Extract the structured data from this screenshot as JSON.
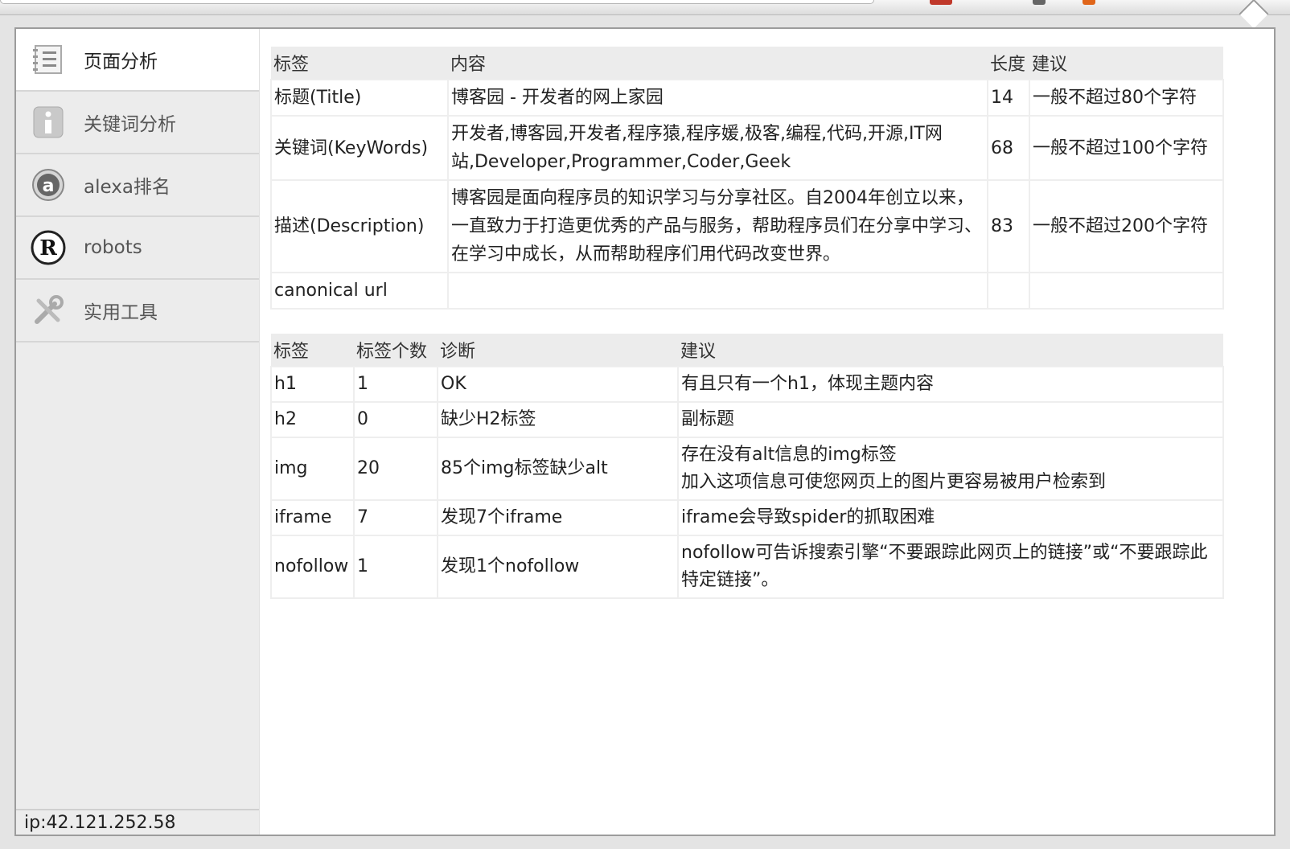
{
  "nav": {
    "items": [
      {
        "label": "页面分析",
        "icon": "document-list-icon"
      },
      {
        "label": "关键词分析",
        "icon": "info-icon"
      },
      {
        "label": "alexa排名",
        "icon": "alexa-icon"
      },
      {
        "label": "robots",
        "icon": "robots-icon"
      },
      {
        "label": "实用工具",
        "icon": "tools-icon"
      }
    ]
  },
  "footer": {
    "ip": "ip:42.121.252.58"
  },
  "meta_table": {
    "headers": [
      "标签",
      "内容",
      "长度",
      "建议"
    ],
    "rows": [
      [
        "标题(Title)",
        "博客园 - 开发者的网上家园",
        "14",
        "一般不超过80个字符"
      ],
      [
        "关键词(KeyWords)",
        "开发者,博客园,开发者,程序猿,程序媛,极客,编程,代码,开源,IT网站,Developer,Programmer,Coder,Geek",
        "68",
        "一般不超过100个字符"
      ],
      [
        "描述(Description)",
        "博客园是面向程序员的知识学习与分享社区。自2004年创立以来，一直致力于打造更优秀的产品与服务，帮助程序员们在分享中学习、在学习中成长，从而帮助程序们用代码改变世界。",
        "83",
        "一般不超过200个字符"
      ],
      [
        "canonical url",
        "",
        "",
        ""
      ]
    ]
  },
  "tag_table": {
    "headers": [
      "标签",
      "标签个数",
      "诊断",
      "建议"
    ],
    "rows": [
      [
        "h1",
        "1",
        "OK",
        "有且只有一个h1，体现主题内容"
      ],
      [
        "h2",
        "0",
        "缺少H2标签",
        "副标题"
      ],
      [
        "img",
        "20",
        "85个img标签缺少alt",
        "存在没有alt信息的img标签\n加入这项信息可使您网页上的图片更容易被用户检索到"
      ],
      [
        "iframe",
        "7",
        "发现7个iframe",
        "iframe会导致spider的抓取困难"
      ],
      [
        "nofollow",
        "1",
        "发现1个nofollow",
        "nofollow可告诉搜索引擎“不要跟踪此网页上的链接”或“不要跟踪此特定链接”。"
      ]
    ]
  }
}
